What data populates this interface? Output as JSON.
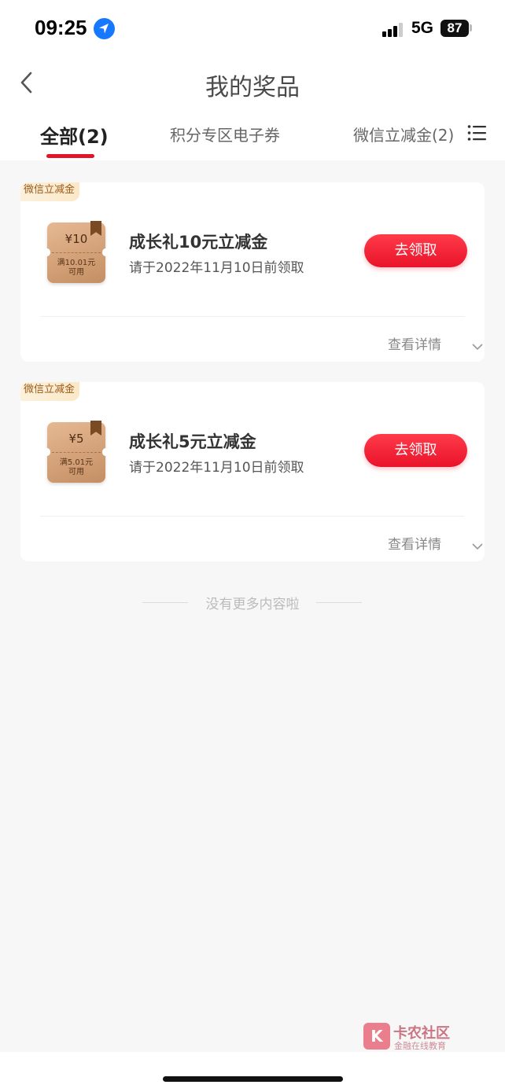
{
  "status_bar": {
    "time": "09:25",
    "network": "5G",
    "battery": "87"
  },
  "nav": {
    "title": "我的奖品"
  },
  "tabs": [
    {
      "label": "全部(2)",
      "active": true
    },
    {
      "label": "积分专区电子券",
      "active": false
    },
    {
      "label": "微信立减金(2)",
      "active": false
    }
  ],
  "prizes": [
    {
      "tag": "微信立减金",
      "coupon_amount": "¥10",
      "coupon_condition_line1": "满10.01元",
      "coupon_condition_line2": "可用",
      "name": "成长礼10元立减金",
      "deadline": "请于2022年11月10日前领取",
      "action": "去领取",
      "detail": "查看详情"
    },
    {
      "tag": "微信立减金",
      "coupon_amount": "¥5",
      "coupon_condition_line1": "满5.01元",
      "coupon_condition_line2": "可用",
      "name": "成长礼5元立减金",
      "deadline": "请于2022年11月10日前领取",
      "action": "去领取",
      "detail": "查看详情"
    }
  ],
  "end_note": "没有更多内容啦",
  "watermark": {
    "logo": "K",
    "title": "卡农社区",
    "subtitle": "金融在线教育"
  },
  "colors": {
    "accent": "#e5132a",
    "button": "#ff3b4a",
    "tag_text": "#9b5a1a",
    "coupon": "#d4a07a"
  }
}
